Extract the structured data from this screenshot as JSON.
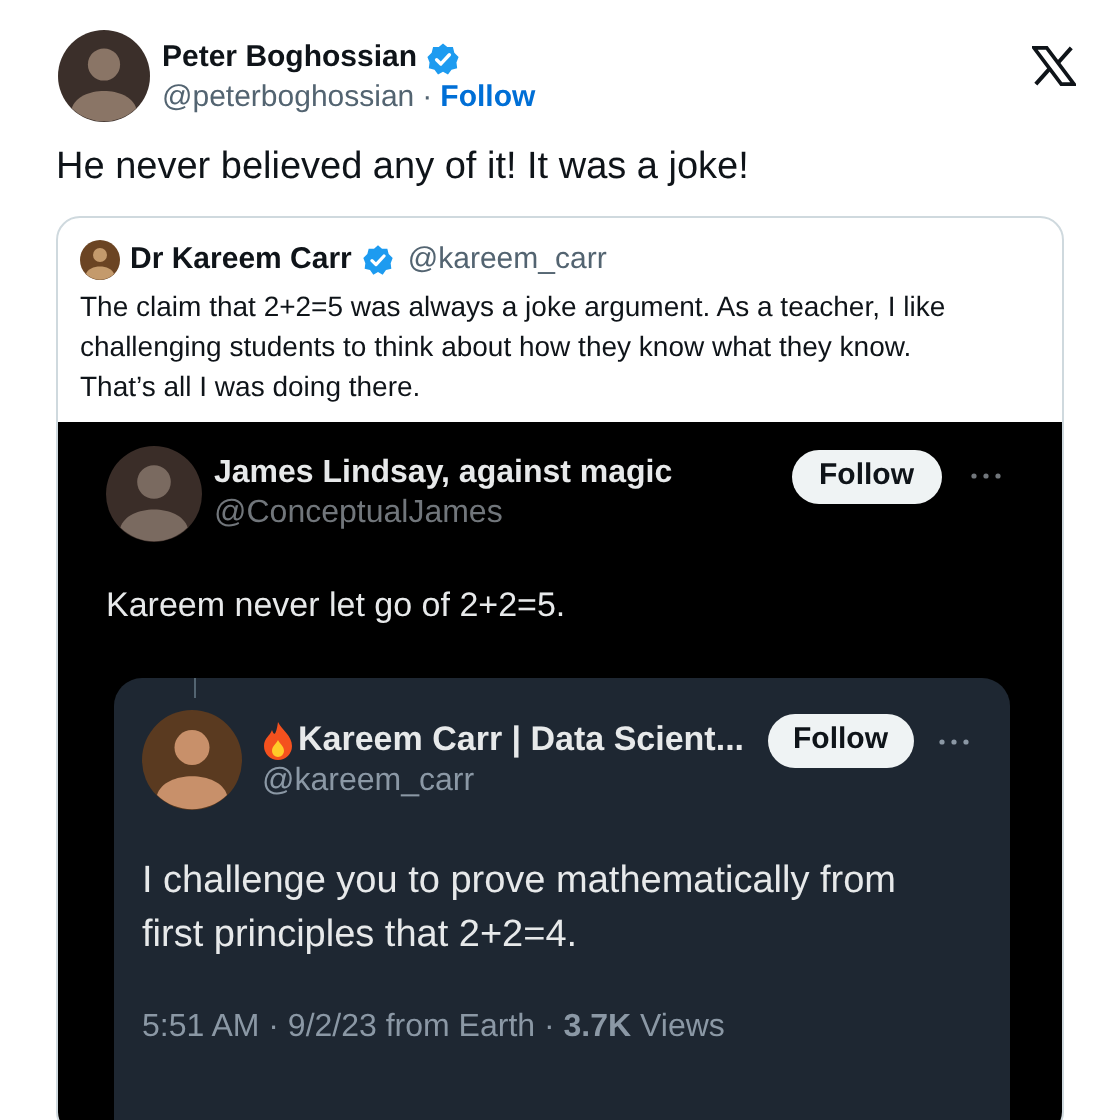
{
  "tweet": {
    "name": "Peter Boghossian",
    "verified": true,
    "handle": "@peterboghossian",
    "separator": "·",
    "follow": "Follow",
    "text": "He never believed any of it! It was a joke!"
  },
  "quote": {
    "name": "Dr Kareem Carr",
    "verified": true,
    "handle": "@kareem_carr",
    "text": "The claim that 2+2=5 was always a joke argument. As a teacher, I like challenging students to think about how they know what they know. That’s all I was doing there.",
    "screenshot": {
      "name": "James Lindsay, against magic",
      "handle": "@ConceptualJames",
      "follow": "Follow",
      "text": "Kareem never let go of 2+2=5.",
      "quoted": {
        "name": "Kareem Carr | Data Scient...",
        "handle": "@kareem_carr",
        "follow": "Follow",
        "text": "I challenge you to prove mathematically from first principles that 2+2=4.",
        "footer": "5:51 AM · 9/2/23 from Earth · **3.7K** Views"
      }
    }
  }
}
